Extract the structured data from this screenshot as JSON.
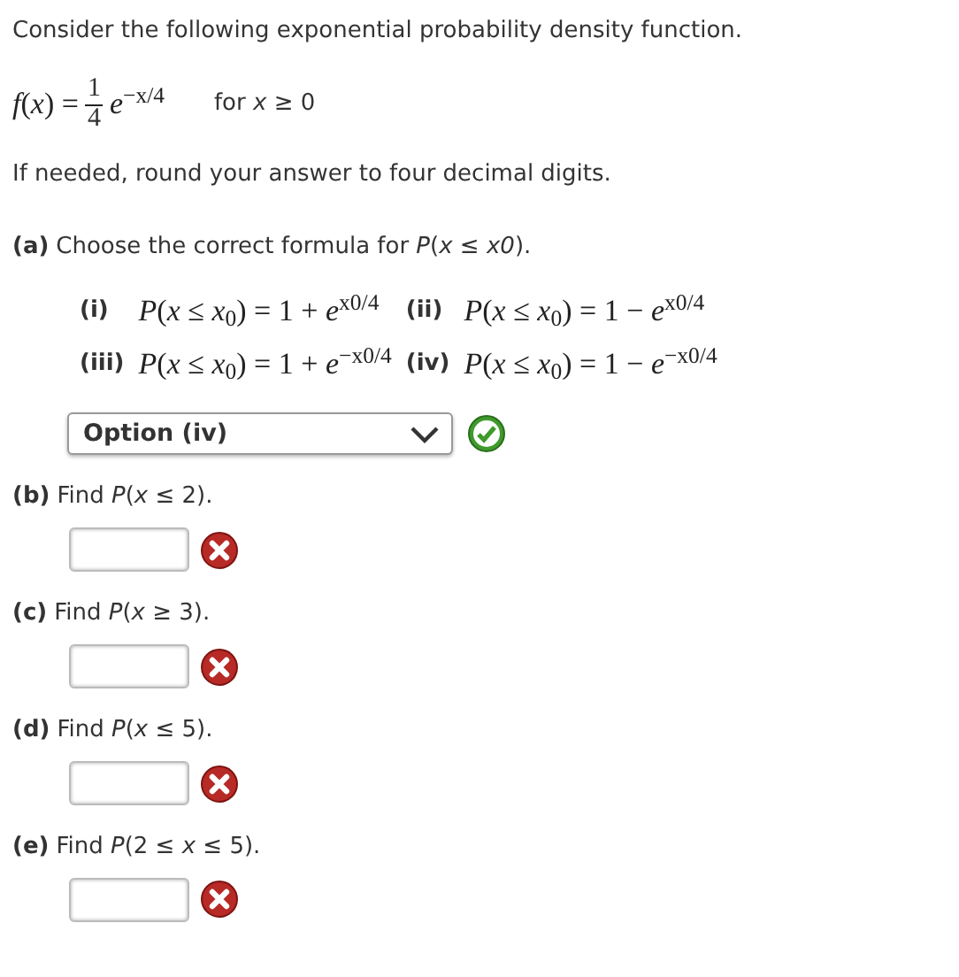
{
  "intro": "Consider the following exponential probability density function.",
  "density": {
    "lhs": "*f*(*x*) =",
    "numerator": "1",
    "denominator": "4",
    "rest": "*e*$^{−x/4}$",
    "condition": "for *x* ≥ 0"
  },
  "note": "If needed, round your answer to four decimal digits.",
  "part_a": {
    "label": "(a)",
    "question": "Choose the correct formula for *P*(*x* ≤ *x0*).",
    "options": [
      {
        "label": "(i)",
        "formula": "*P*(*x* ≤ *x*$_{0}$) = 1 + *e*$^{x0/4}$"
      },
      {
        "label": "(ii)",
        "formula": "*P*(*x* ≤ *x*$_{0}$) = 1 − *e*$^{x0/4}$"
      },
      {
        "label": "(iii)",
        "formula": "*P*(*x* ≤ *x*$_{0}$) = 1 + *e*$^{−x0/4}$"
      },
      {
        "label": "(iv)",
        "formula": "*P*(*x* ≤ *x*$_{0}$) = 1 − *e*$^{−x0/4}$"
      }
    ],
    "answer": "Option (iv)",
    "correct": true
  },
  "parts": [
    {
      "label": "(b)",
      "question": "Find *P*(*x* ≤ 2).",
      "correct": false
    },
    {
      "label": "(c)",
      "question": "Find *P*(*x* ≥ 3).",
      "correct": false
    },
    {
      "label": "(d)",
      "question": "Find *P*(*x* ≤ 5).",
      "correct": false
    },
    {
      "label": "(e)",
      "question": "Find *P*(2 ≤ *x* ≤ 5).",
      "correct": false
    }
  ]
}
